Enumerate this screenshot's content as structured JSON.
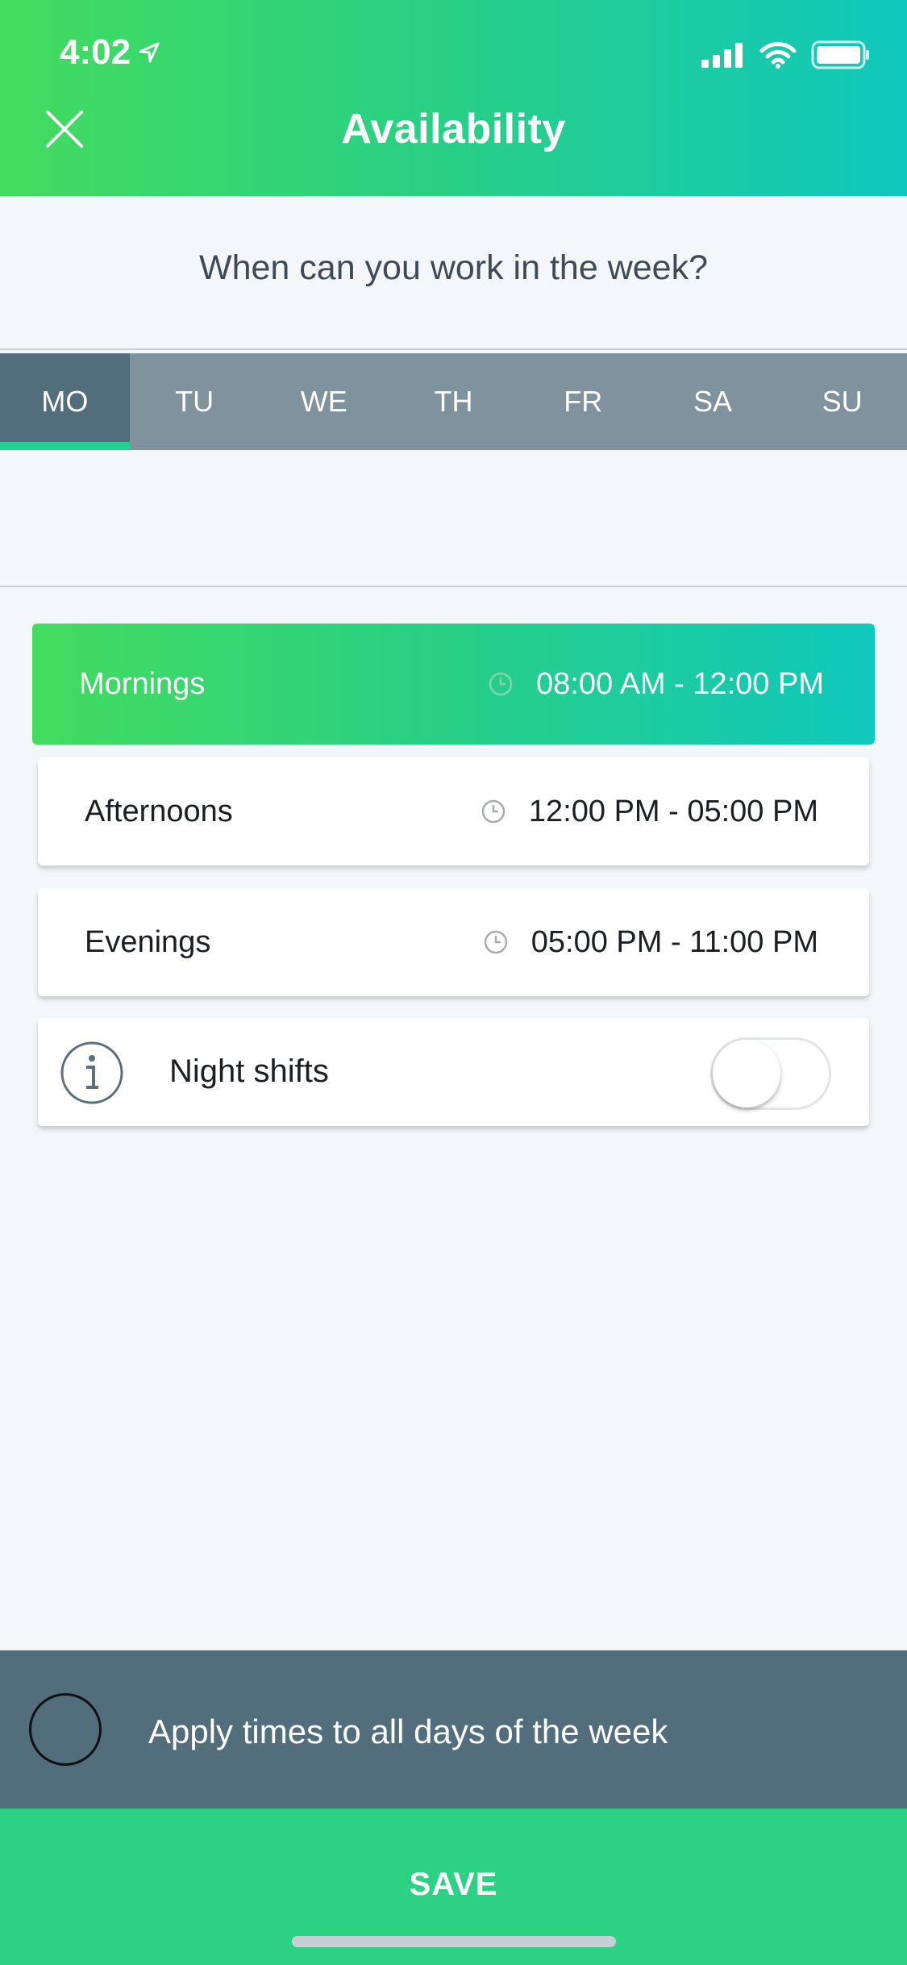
{
  "status_bar": {
    "time": "4:02"
  },
  "header": {
    "title": "Availability"
  },
  "question": "When can you work in the week?",
  "days": [
    {
      "label": "MO",
      "active": true
    },
    {
      "label": "TU",
      "active": false
    },
    {
      "label": "WE",
      "active": false
    },
    {
      "label": "TH",
      "active": false
    },
    {
      "label": "FR",
      "active": false
    },
    {
      "label": "SA",
      "active": false
    },
    {
      "label": "SU",
      "active": false
    }
  ],
  "slots": [
    {
      "label": "Mornings",
      "time": "08:00 AM - 12:00 PM",
      "selected": true
    },
    {
      "label": "Afternoons",
      "time": "12:00 PM - 05:00 PM",
      "selected": false
    },
    {
      "label": "Evenings",
      "time": "05:00 PM - 11:00 PM",
      "selected": false
    }
  ],
  "night_shifts": {
    "label": "Night shifts",
    "enabled": false
  },
  "apply_all": {
    "label": "Apply times to all days of the week",
    "checked": false
  },
  "save_label": "SAVE",
  "colors": {
    "brand_green": "#2dd184",
    "slate": "#526e7c",
    "tab_gray": "#7f929d",
    "teal": "#10c8bd"
  }
}
